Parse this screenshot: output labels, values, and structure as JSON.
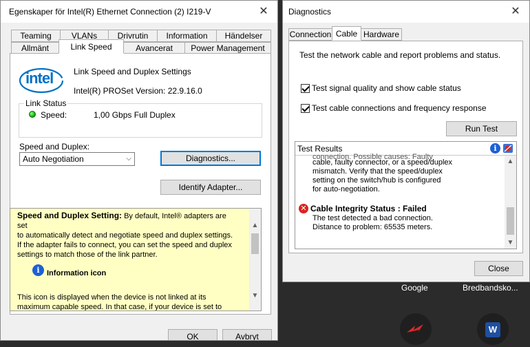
{
  "left_window": {
    "title": "Egenskaper för Intel(R) Ethernet Connection (2) I219-V",
    "tabs_row1": [
      "Teaming",
      "VLANs",
      "Drivrutin",
      "Information",
      "Händelser"
    ],
    "tabs_row2": [
      "Allmänt",
      "Link Speed",
      "Avancerat",
      "Power Management"
    ],
    "active_tab": "Link Speed",
    "logo_text": "intel",
    "heading": "Link Speed and Duplex Settings",
    "version": "Intel(R) PROSet Version: 22.9.16.0",
    "link_status": {
      "legend": "Link Status",
      "speed_label": "Speed:",
      "speed_value": "1,00 Gbps Full Duplex",
      "indicator_color": "#14b514"
    },
    "speed_duplex": {
      "label": "Speed and Duplex:",
      "selected": "Auto Negotiation"
    },
    "buttons": {
      "diagnostics": "Diagnostics...",
      "identify": "Identify Adapter...",
      "ok": "OK",
      "cancel": "Avbryt"
    },
    "help": {
      "bold_lead": "Speed and Duplex Setting:",
      "para1_line1": "By default, Intel® adapters are set",
      "para1_line2": "to automatically detect and negotiate speed and duplex settings.",
      "para1_line3": "If the adapter fails to connect, you can set the speed and duplex",
      "para1_line4": "settings to match those of the link partner.",
      "info_heading": "Information icon",
      "para2_line1": "This icon is displayed when the device is not linked at its",
      "para2_line2": "maximum capable speed. In that case, if your device is set to",
      "background_color": "#ffffc4"
    }
  },
  "right_window": {
    "title": "Diagnostics",
    "tabs": [
      "Connection",
      "Cable",
      "Hardware"
    ],
    "active_tab": "Cable",
    "description": "Test the network cable and report problems and status.",
    "options": [
      {
        "label": "Test signal quality and show cable status",
        "checked": true
      },
      {
        "label": "Test cable connections and frequency response",
        "checked": true
      }
    ],
    "run_button": "Run Test",
    "results": {
      "header": "Test Results",
      "lines": [
        "connection. Possible causes: Faulty",
        "cable, faulty connector, or a speed/duplex",
        "mismatch. Verify that the speed/duplex",
        "setting on the switch/hub is configured",
        "for auto-negotiation."
      ],
      "failed_title": "Cable Integrity Status : Failed",
      "failed_lines": [
        "The test detected a bad connection.",
        "Distance to problem:  65535 meters."
      ]
    },
    "close_button": "Close"
  },
  "desktop": {
    "apps": [
      "Google",
      "Bredbandsko..."
    ],
    "badge_letter": "W"
  },
  "colors": {
    "accent": "#0078d7",
    "error": "#d9251d",
    "info": "#1d60d6"
  }
}
